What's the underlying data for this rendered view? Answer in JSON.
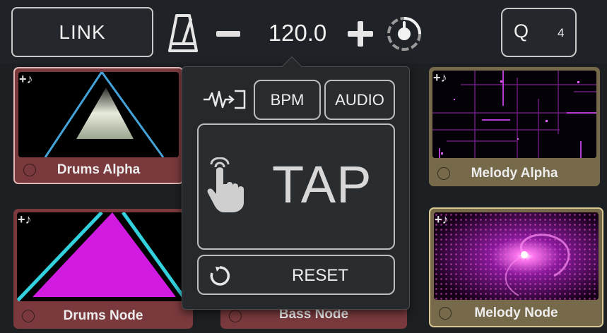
{
  "topbar": {
    "link_label": "LINK",
    "tempo_value": "120.0",
    "quantize_label": "Q",
    "quantize_value": "4"
  },
  "icons": {
    "metronome": "metronome-icon",
    "minus": "minus-icon",
    "plus": "plus-icon",
    "clock": "clock-icon",
    "note": "add-note-icon",
    "source": "audio-input-icon",
    "hand": "tap-hand-icon",
    "reset": "reset-icon"
  },
  "tiles": {
    "drums_alpha": "Drums Alpha",
    "drums_node": "Drums Node",
    "bass_node": "Bass Node",
    "melody_alpha": "Melody Alpha",
    "melody_node": "Melody Node",
    "note_glyph": "+♪"
  },
  "popover": {
    "bpm_label": "BPM",
    "audio_label": "AUDIO",
    "tap_label": "TAP",
    "reset_label": "RESET"
  },
  "colors": {
    "red_tile": "#7a3a3d",
    "olive_tile": "#766a4a",
    "magenta": "#d21be0",
    "cyan": "#33d0dd",
    "background": "#1d2023"
  }
}
